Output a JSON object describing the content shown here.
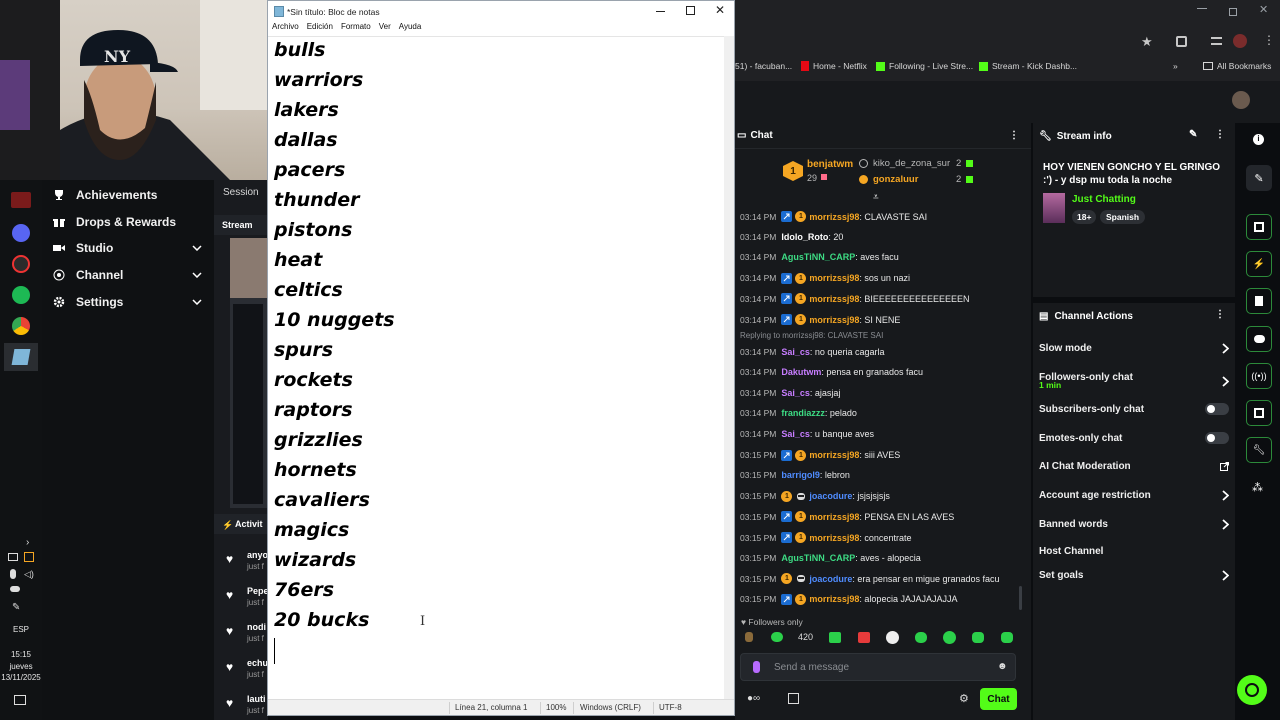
{
  "notepad": {
    "title": "*Sin título: Bloc de notas",
    "menu": [
      "Archivo",
      "Edición",
      "Formato",
      "Ver",
      "Ayuda"
    ],
    "lines": [
      "bulls",
      "warriors",
      "lakers",
      "dallas",
      "pacers",
      "thunder",
      "pistons",
      "heat",
      "celtics",
      "10 nuggets",
      "spurs",
      "rockets",
      "raptors",
      "grizzlies",
      "hornets",
      "cavaliers",
      "magics",
      "wizards",
      "76ers",
      "20 bucks"
    ],
    "status": {
      "position": "Línea 21, columna 1",
      "zoom": "100%",
      "line_ending": "Windows (CRLF)",
      "encoding": "UTF-8"
    }
  },
  "browser": {
    "bookmarks": [
      {
        "label": "51) - facuban...",
        "color": "#9aa0a6"
      },
      {
        "label": "Home - Netflix",
        "color": "#e50914"
      },
      {
        "label": "Following - Live Stre...",
        "color": "#53fc18"
      },
      {
        "label": "Stream - Kick Dashb...",
        "color": "#53fc18"
      }
    ],
    "all_bookmarks": "All Bookmarks"
  },
  "kick_nav": {
    "items": [
      {
        "label": "Achievements",
        "icon": "trophy-icon"
      },
      {
        "label": "Drops & Rewards",
        "icon": "gift-icon"
      },
      {
        "label": "Studio",
        "icon": "video-icon"
      },
      {
        "label": "Channel",
        "icon": "broadcast-icon"
      },
      {
        "label": "Settings",
        "icon": "gear-icon"
      }
    ],
    "session_label": "Session",
    "stream_label": "Stream",
    "activity_label": "Activit",
    "activity_items": [
      {
        "name": "anyo",
        "sub": "just f"
      },
      {
        "name": "Pepe",
        "sub": "just f"
      },
      {
        "name": "nodi",
        "sub": "just f"
      },
      {
        "name": "echu",
        "sub": "just f"
      },
      {
        "name": "lauti",
        "sub": "just f"
      }
    ]
  },
  "chat": {
    "title": "Chat",
    "leader": {
      "rank": "1",
      "name": "benjatwm",
      "count": "29"
    },
    "top": [
      {
        "name": "kiko_de_zona_sur",
        "count": "2"
      },
      {
        "name": "gonzaluur",
        "count": "2"
      }
    ],
    "messages": [
      {
        "time": "03:14 PM",
        "user": "morrizssj98",
        "color": "#f5a623",
        "badges": [
          "v",
          "c"
        ],
        "text": ": CLAVASTE SAI"
      },
      {
        "time": "03:14 PM",
        "user": "Idolo_Roto",
        "color": "#ffffff",
        "badges": [],
        "text": ": 20"
      },
      {
        "time": "03:14 PM",
        "user": "AgusTiNN_CARP",
        "color": "#3ddc84",
        "badges": [],
        "text": ": aves facu"
      },
      {
        "time": "03:14 PM",
        "user": "morrizssj98",
        "color": "#f5a623",
        "badges": [
          "v",
          "c"
        ],
        "text": ": sos un nazi"
      },
      {
        "time": "03:14 PM",
        "user": "morrizssj98",
        "color": "#f5a623",
        "badges": [
          "v",
          "c"
        ],
        "text": ": BIEEEEEEEEEEEEEEEN"
      },
      {
        "time": "03:14 PM",
        "user": "morrizssj98",
        "color": "#f5a623",
        "badges": [
          "v",
          "c"
        ],
        "text": ": SI NENE"
      },
      {
        "time": "03:14 PM",
        "user": "Sai_cs",
        "color": "#c77dff",
        "badges": [],
        "text": ": no queria cagarla",
        "reply": "Replying to morrizssj98: CLAVASTE SAI"
      },
      {
        "time": "03:14 PM",
        "user": "Dakutwm",
        "color": "#c77dff",
        "badges": [],
        "text": ": pensa en granados facu"
      },
      {
        "time": "03:14 PM",
        "user": "Sai_cs",
        "color": "#c77dff",
        "badges": [],
        "text": ": ajasjaj"
      },
      {
        "time": "03:14 PM",
        "user": "frandiazzz",
        "color": "#3ddc84",
        "badges": [],
        "text": ": pelado"
      },
      {
        "time": "03:14 PM",
        "user": "Sai_cs",
        "color": "#c77dff",
        "badges": [],
        "text": ": u banque aves"
      },
      {
        "time": "03:15 PM",
        "user": "morrizssj98",
        "color": "#f5a623",
        "badges": [
          "v",
          "c"
        ],
        "text": ": siii AVES"
      },
      {
        "time": "03:15 PM",
        "user": "barrigol9",
        "color": "#4f8cff",
        "badges": [],
        "text": ": lebron"
      },
      {
        "time": "03:15 PM",
        "user": "joacodure",
        "color": "#4f8cff",
        "badges": [
          "c",
          "b"
        ],
        "text": ": jsjsjsjsjs"
      },
      {
        "time": "03:15 PM",
        "user": "morrizssj98",
        "color": "#f5a623",
        "badges": [
          "v",
          "c"
        ],
        "text": ": PENSA EN LAS AVES"
      },
      {
        "time": "03:15 PM",
        "user": "morrizssj98",
        "color": "#f5a623",
        "badges": [
          "v",
          "c"
        ],
        "text": ": concentrate"
      },
      {
        "time": "03:15 PM",
        "user": "AgusTiNN_CARP",
        "color": "#3ddc84",
        "badges": [],
        "text": ": aves - alopecia"
      },
      {
        "time": "03:15 PM",
        "user": "joacodure",
        "color": "#4f8cff",
        "badges": [
          "c",
          "b"
        ],
        "text": ": era pensar en migue granados facu"
      },
      {
        "time": "03:15 PM",
        "user": "morrizssj98",
        "color": "#f5a623",
        "badges": [
          "v",
          "c"
        ],
        "text": ": alopecia JAJAJAJAJJA"
      }
    ],
    "followers_only": "Followers only",
    "placeholder": "Send a message",
    "send_label": "Chat",
    "emote_text": "420"
  },
  "stream_info": {
    "title": "Stream info",
    "stream_title": "HOY VIENEN GONCHO Y EL GRINGO :') - y dsp mu toda la noche",
    "category": "Just Chatting",
    "tags": [
      "18+",
      "Spanish"
    ]
  },
  "channel_actions": {
    "title": "Channel Actions",
    "rows": [
      {
        "label": "Slow mode",
        "control": "chevron"
      },
      {
        "label": "Followers-only chat",
        "sub": "1 min",
        "control": "chevron"
      },
      {
        "label": "Subscribers-only chat",
        "control": "toggle"
      },
      {
        "label": "Emotes-only chat",
        "control": "toggle"
      },
      {
        "label": "AI Chat Moderation",
        "control": "external"
      },
      {
        "label": "Account age restriction",
        "control": "chevron"
      },
      {
        "label": "Banned words",
        "control": "chevron"
      },
      {
        "label": "Host Channel",
        "control": "none"
      },
      {
        "label": "Set goals",
        "control": "chevron"
      }
    ]
  },
  "taskbar": {
    "lang": "ESP",
    "time": "15:15",
    "day": "jueves",
    "date": "13/11/2025"
  },
  "colors": {
    "kick_green": "#53fc18",
    "panel": "#17191c",
    "page": "#0b0d10"
  }
}
